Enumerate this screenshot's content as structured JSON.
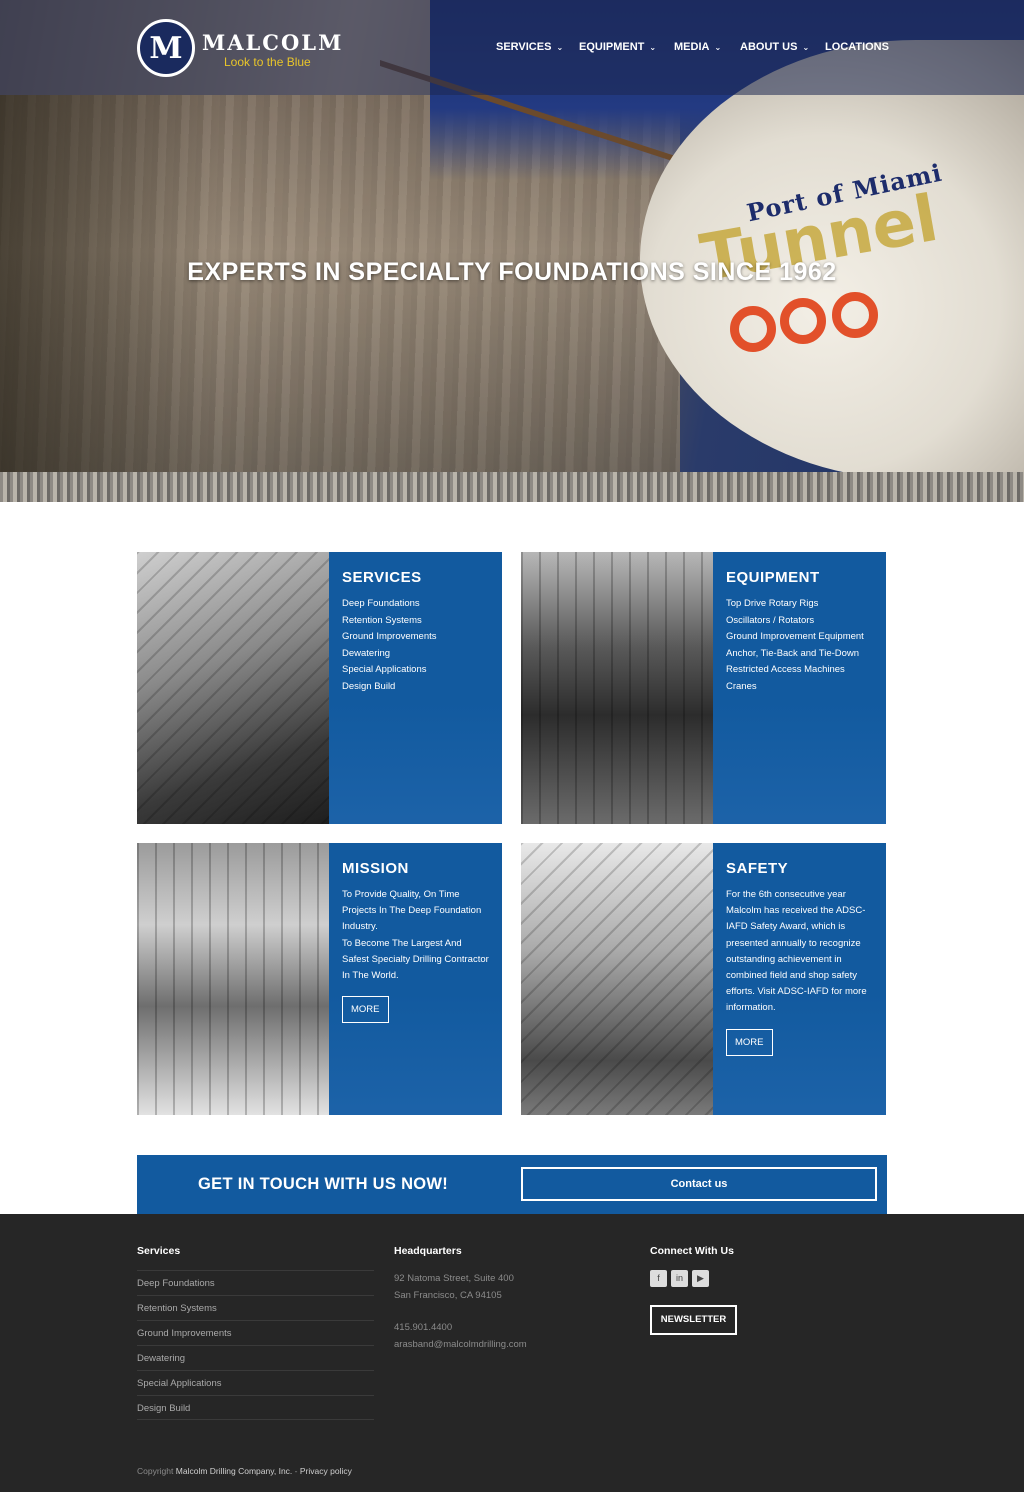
{
  "header": {
    "logo_letter": "M",
    "brand": "MALCOLM",
    "tagline": "Look to the Blue",
    "nav": [
      {
        "label": "SERVICES",
        "has_dropdown": true
      },
      {
        "label": "EQUIPMENT",
        "has_dropdown": true
      },
      {
        "label": "MEDIA",
        "has_dropdown": true
      },
      {
        "label": "ABOUT US",
        "has_dropdown": true
      },
      {
        "label": "LOCATIONS",
        "has_dropdown": false
      }
    ],
    "chevron": "⌄"
  },
  "hero": {
    "title": "EXPERTS IN SPECIALTY FOUNDATIONS SINCE 1962",
    "machine_text_1": "Port of Miami",
    "machine_text_2": "Tunnel"
  },
  "cards": {
    "services": {
      "title": "SERVICES",
      "items": [
        "Deep Foundations",
        "Retention Systems",
        "Ground Improvements",
        "Dewatering",
        "Special Applications",
        "Design Build"
      ]
    },
    "equipment": {
      "title": "EQUIPMENT",
      "items": [
        "Top Drive Rotary Rigs",
        "Oscillators / Rotators",
        "Ground Improvement Equipment",
        "Anchor, Tie-Back and Tie-Down",
        "Restricted Access Machines",
        "Cranes"
      ]
    },
    "mission": {
      "title": "MISSION",
      "text_1": "To Provide Quality, On Time Projects In The Deep Foundation Industry.",
      "text_2": "To Become The Largest And Safest Specialty Drilling Contractor In The World.",
      "button": "MORE"
    },
    "safety": {
      "title": "SAFETY",
      "text": "For the 6th consecutive year Malcolm has received the ADSC-IAFD Safety Award, which is presented annually to recognize outstanding achievement in combined field and shop safety efforts. Visit ADSC-IAFD for more information.",
      "button": "MORE"
    }
  },
  "cta": {
    "title": "GET IN TOUCH WITH US NOW!",
    "button": "Contact us"
  },
  "footer": {
    "services_heading": "Services",
    "services": [
      "Deep Foundations",
      "Retention Systems",
      "Ground Improvements",
      "Dewatering",
      "Special Applications",
      "Design Build"
    ],
    "hq_heading": "Headquarters",
    "address_1": "92 Natoma Street, Suite 400",
    "address_2": "San Francisco, CA 94105",
    "phone": "415.901.4400",
    "email": "arasband@malcolmdrilling.com",
    "connect_heading": "Connect With Us",
    "social": [
      {
        "icon": "facebook-icon",
        "glyph": "f"
      },
      {
        "icon": "linkedin-icon",
        "glyph": "in"
      },
      {
        "icon": "youtube-icon",
        "glyph": "▶"
      }
    ],
    "newsletter": "NEWSLETTER",
    "copyright_prefix": "Copyright",
    "company": "Malcolm Drilling Company, Inc.",
    "separator": "-",
    "privacy": "Privacy policy"
  },
  "colors": {
    "primary_blue": "#125a9f",
    "footer_bg": "#262626",
    "tagline_yellow": "#e8c52a"
  }
}
